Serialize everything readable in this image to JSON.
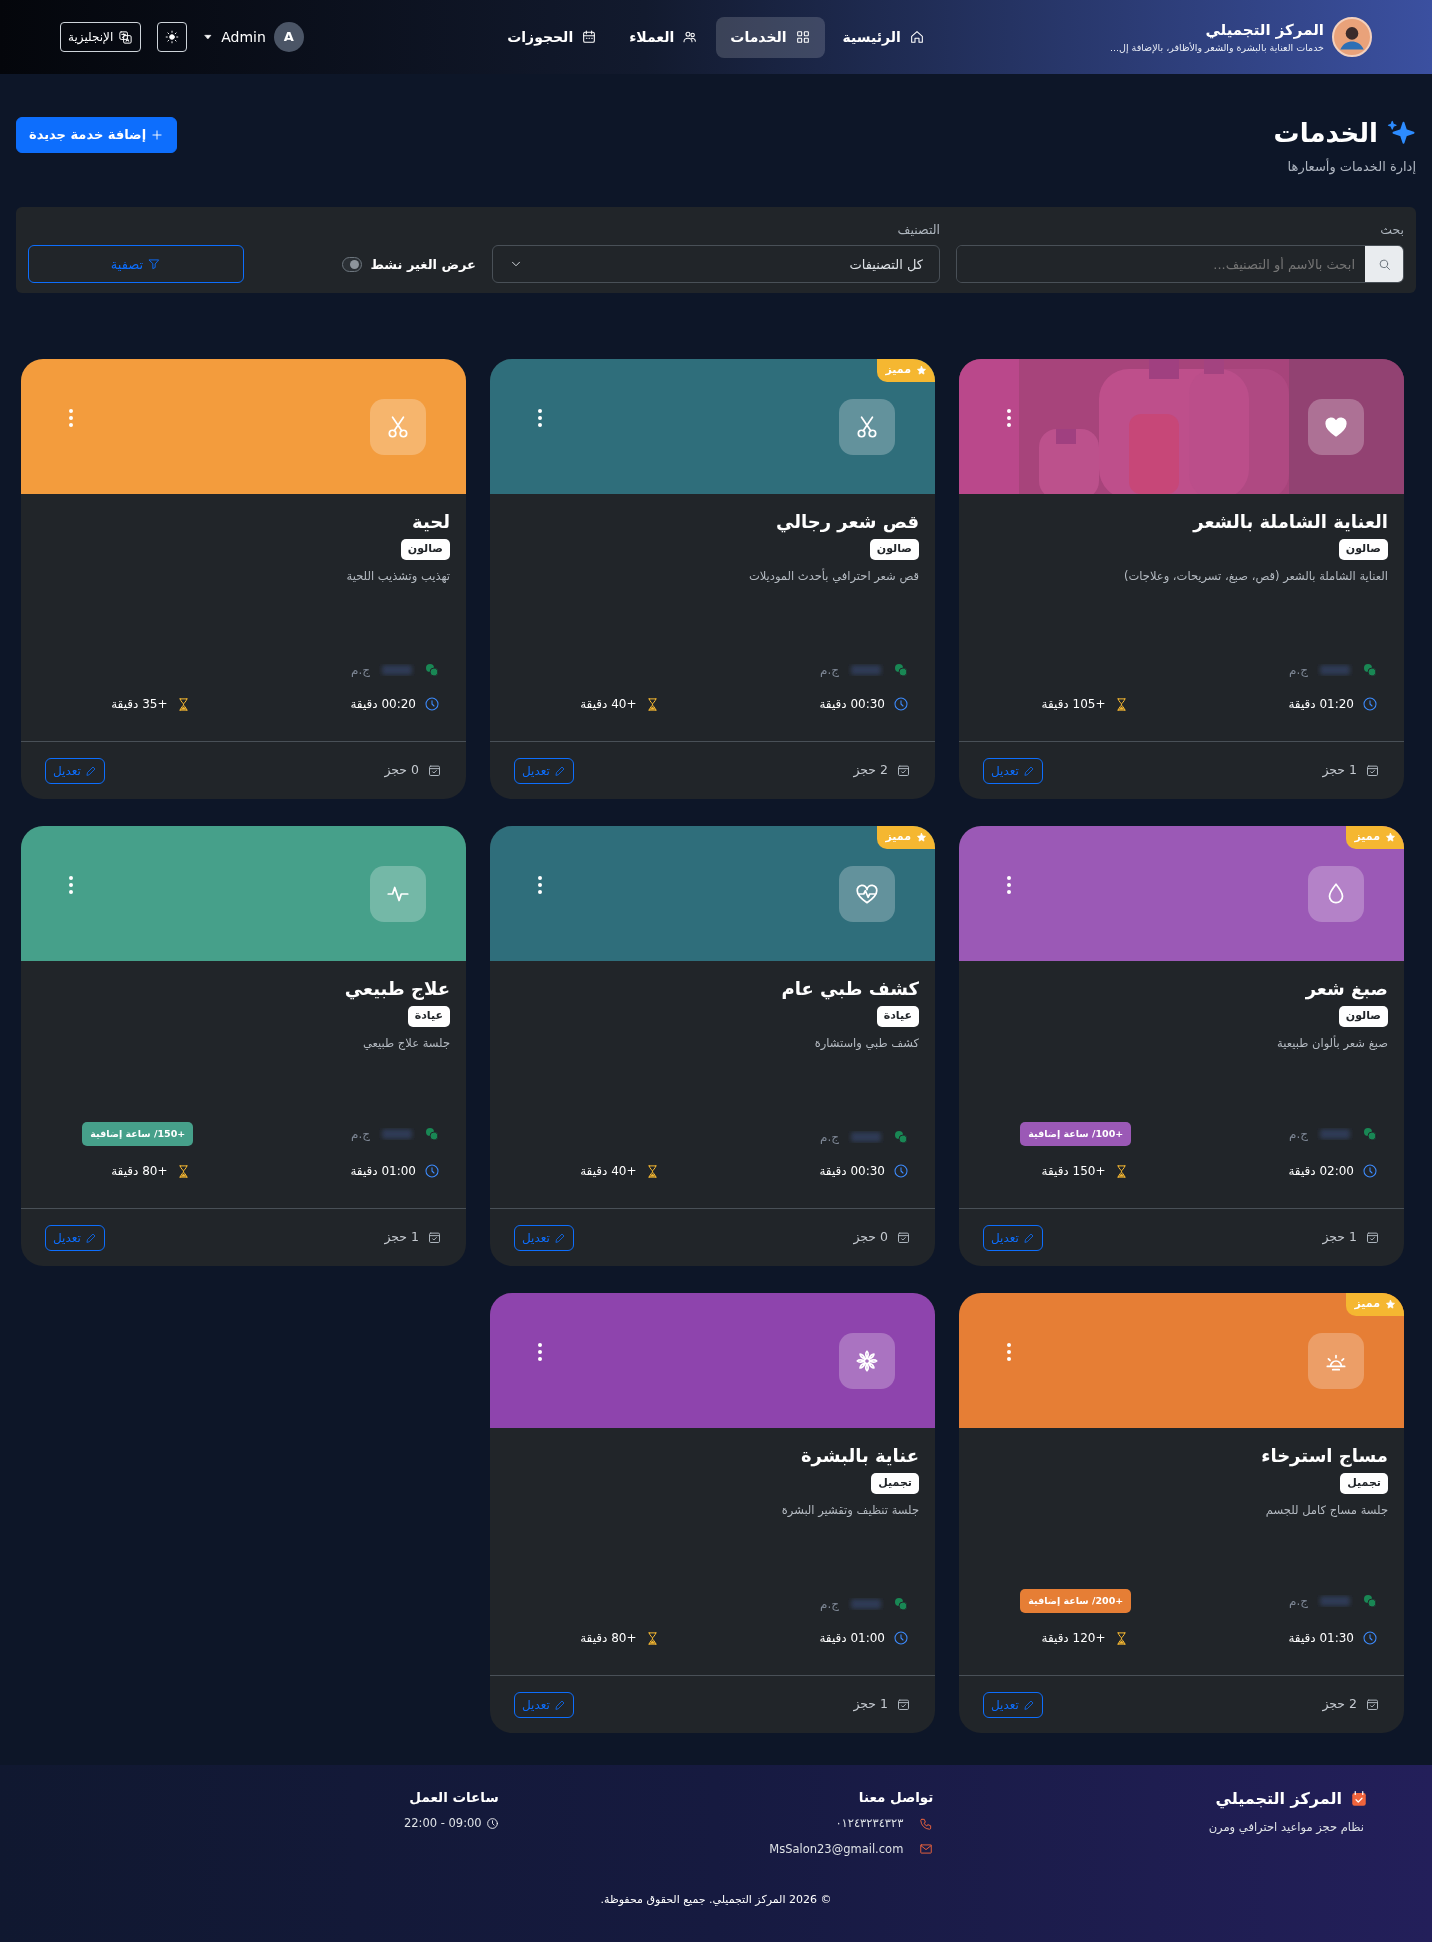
{
  "header": {
    "brand": {
      "title": "المركز التجميلي",
      "subtitle": "خدمات العناية بالبشرة والشعر والأظافر، بالإضافة إل..."
    },
    "nav": [
      {
        "label": "الرئيسية",
        "selected": false
      },
      {
        "label": "الخدمات",
        "selected": true
      },
      {
        "label": "العملاء",
        "selected": false
      },
      {
        "label": "الحجوزات",
        "selected": false
      }
    ],
    "user": {
      "initial": "A",
      "name": "Admin"
    },
    "language_button": "الإنجليزية"
  },
  "page": {
    "title": "الخدمات",
    "subtitle": "إدارة الخدمات وأسعارها",
    "add_button": "إضافة خدمة جديدة"
  },
  "filters": {
    "search_label": "بحث",
    "search_placeholder": "ابحث بالاسم أو التصنيف...",
    "category_label": "التصنيف",
    "category_value": "كل التصنيفات",
    "inactive_label": "عرض الغير نشط",
    "inactive_on": false,
    "filter_button": "تصفية"
  },
  "services": [
    {
      "color": "#c0407f",
      "title": "العناية الشاملة بالشعر",
      "category": "صالون",
      "description": "العناية الشاملة بالشعر (قص، صبغ، تسريحات، وعلاجات)",
      "currency": "ج.م",
      "duration": "01:20 دقيقة",
      "buffer": "+105 دقيقة",
      "bookings": "1 حجز",
      "edit": "تعديل"
    },
    {
      "kind": "plain",
      "color": "#2f6e7b",
      "featured_badge": "مميز",
      "title": "قص شعر رجالي",
      "category": "صالون",
      "description": "قص شعر احترافي بأحدث الموديلات",
      "currency": "ج.م",
      "duration": "00:30 دقيقة",
      "buffer": "+40 دقيقة",
      "bookings": "2 حجز",
      "edit": "تعديل"
    },
    {
      "kind": "plain",
      "color": "#f39c3d",
      "title": "لحية",
      "category": "صالون",
      "description": "تهذيب وتشذيب اللحية",
      "currency": "ج.م",
      "duration": "00:20 دقيقة",
      "buffer": "+35 دقيقة",
      "bookings": "0 حجز",
      "edit": "تعديل"
    },
    {
      "kind": "plain",
      "color": "#9b59b6",
      "featured_badge": "مميز",
      "title": "صبغ شعر",
      "category": "صالون",
      "description": "صبغ شعر بألوان طبيعية",
      "currency": "ج.م",
      "extra_rate": {
        "text": "+100/ ساعة إضافية",
        "color": "#9b59b6"
      },
      "duration": "02:00 دقيقة",
      "buffer": "+150 دقيقة",
      "bookings": "1 حجز",
      "edit": "تعديل"
    },
    {
      "kind": "plain",
      "color": "#2f6e7b",
      "featured_badge": "مميز",
      "title": "كشف طبي عام",
      "category": "عيادة",
      "description": "كشف طبي واستشارة",
      "currency": "ج.م",
      "duration": "00:30 دقيقة",
      "buffer": "+40 دقيقة",
      "bookings": "0 حجز",
      "edit": "تعديل"
    },
    {
      "kind": "plain",
      "color": "#46a08a",
      "title": "علاج طبيعي",
      "category": "عيادة",
      "description": "جلسة علاج طبيعي",
      "currency": "ج.م",
      "extra_rate": {
        "text": "+150/ ساعة إضافية",
        "color": "#46a08a"
      },
      "duration": "01:00 دقيقة",
      "buffer": "+80 دقيقة",
      "bookings": "1 حجز",
      "edit": "تعديل"
    },
    {
      "kind": "plain",
      "color": "#e67e35",
      "featured_badge": "مميز",
      "title": "مساج استرخاء",
      "category": "تجميل",
      "description": "جلسة مساج كامل للجسم",
      "currency": "ج.م",
      "extra_rate": {
        "text": "+200/ ساعة إضافية",
        "color": "#e67e35"
      },
      "duration": "01:30 دقيقة",
      "buffer": "+120 دقيقة",
      "bookings": "2 حجز",
      "edit": "تعديل"
    },
    {
      "kind": "plain",
      "color": "#8e44ad",
      "title": "عناية بالبشرة",
      "category": "تجميل",
      "description": "جلسة تنظيف وتقشير البشرة",
      "currency": "ج.م",
      "duration": "01:00 دقيقة",
      "buffer": "+80 دقيقة",
      "bookings": "1 حجز",
      "edit": "تعديل"
    }
  ],
  "footer": {
    "brand": "المركز التجميلي",
    "tagline": "نظام حجز مواعيد احترافي ومرن",
    "contact_title": "تواصل معنا",
    "phone": "٠١٢٤٣٢٣٤٣٢٣",
    "email": "MsSalon23@gmail.com",
    "hours_title": "ساعات العمل",
    "hours": "22:00 - 09:00",
    "copyright": "© 2026 المركز التجميلي. جميع الحقوق محفوظة."
  }
}
